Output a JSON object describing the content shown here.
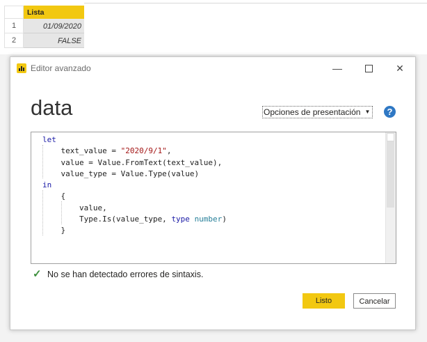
{
  "grid": {
    "column_header": "Lista",
    "rows": [
      {
        "number": "1",
        "value": "01/09/2020"
      },
      {
        "number": "2",
        "value": "FALSE"
      }
    ]
  },
  "dialog": {
    "title": "Editor avanzado",
    "query_name": "data",
    "display_options_label": "Opciones de presentación",
    "help_icon_glyph": "?",
    "status_icon": "check-icon",
    "status_text": "No se han detectado errores de sintaxis.",
    "ok_label": "Listo",
    "cancel_label": "Cancelar",
    "minimize_glyph": "—",
    "close_glyph": "✕"
  },
  "code": {
    "kw_let": "let",
    "line2_a": "    text_value = ",
    "line2_str": "\"2020/9/1\"",
    "line2_b": ",",
    "line3": "    value = Value.FromText(text_value),",
    "line4": "    value_type = Value.Type(value)",
    "kw_in": "in",
    "line6": "    {",
    "line7": "        value,",
    "line8_a": "        Type.Is(value_type, ",
    "line8_kw": "type",
    "line8_sp": " ",
    "line8_typ": "number",
    "line8_b": ")",
    "line9": "    }"
  },
  "colors": {
    "accent": "#f2c811",
    "keyword": "#1a1aa6",
    "string": "#a31515",
    "type": "#267f99",
    "success": "#3c8f3c",
    "help": "#2f78c4"
  }
}
